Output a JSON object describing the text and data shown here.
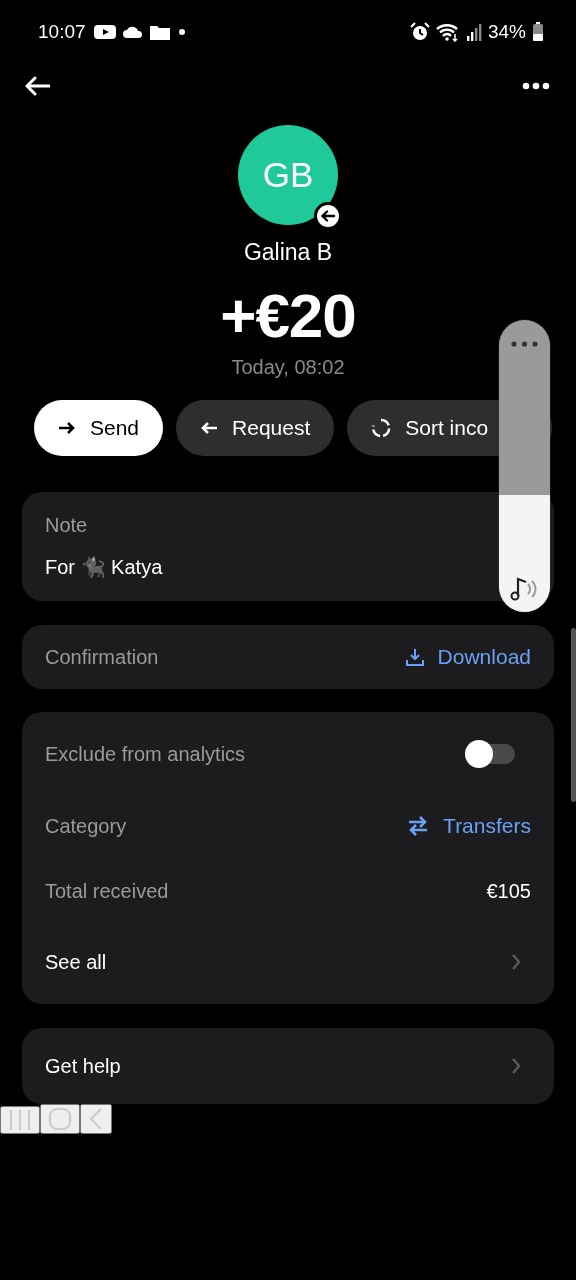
{
  "status_bar": {
    "time": "10:07",
    "battery": "34%"
  },
  "contact": {
    "initials": "GB",
    "name": "Galina B"
  },
  "amount": "+€20",
  "date": "Today, 08:02",
  "actions": [
    {
      "label": "Send",
      "kind": "send",
      "primary": true
    },
    {
      "label": "Request",
      "kind": "request",
      "primary": false
    },
    {
      "label": "Sort inco",
      "kind": "sort",
      "primary": false
    }
  ],
  "note": {
    "label": "Note",
    "text": "For 🐈‍⬛ Katya"
  },
  "confirmation": {
    "label": "Confirmation",
    "action": "Download"
  },
  "details": [
    {
      "kind": "toggle",
      "label": "Exclude from analytics",
      "on": false
    },
    {
      "kind": "link",
      "label": "Category",
      "value": "Transfers"
    },
    {
      "kind": "value",
      "label": "Total received",
      "value": "€105"
    },
    {
      "kind": "nav",
      "label": "See all"
    }
  ],
  "help": {
    "label": "Get help"
  },
  "volume_panel": {
    "level": 0.4
  }
}
